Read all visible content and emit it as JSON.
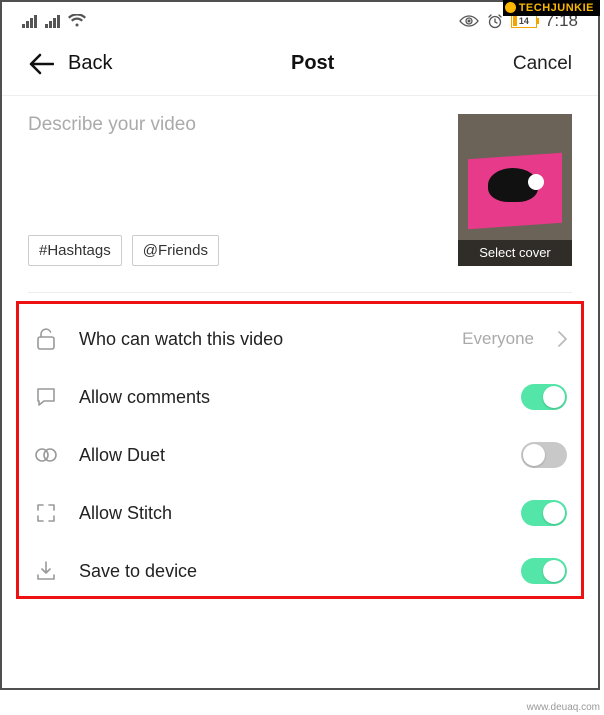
{
  "watermark": {
    "brand": "TECHJUNKIE",
    "site": "www.deuaq.com"
  },
  "statusbar": {
    "battery_pct": "14",
    "time": "7:18"
  },
  "nav": {
    "back": "Back",
    "title": "Post",
    "cancel": "Cancel"
  },
  "compose": {
    "placeholder": "Describe your video",
    "hashtags_label": "#Hashtags",
    "friends_label": "@Friends",
    "cover_label": "Select cover"
  },
  "settings": {
    "privacy": {
      "label": "Who can watch this video",
      "value": "Everyone"
    },
    "comments": {
      "label": "Allow comments",
      "on": true
    },
    "duet": {
      "label": "Allow Duet",
      "on": false
    },
    "stitch": {
      "label": "Allow Stitch",
      "on": true
    },
    "save": {
      "label": "Save to device",
      "on": true
    }
  }
}
